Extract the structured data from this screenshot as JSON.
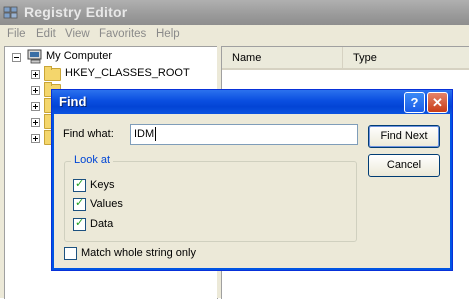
{
  "app": {
    "title": "Registry Editor",
    "menu": [
      "File",
      "Edit",
      "View",
      "Favorites",
      "Help"
    ]
  },
  "tree": {
    "root_label": "My Computer",
    "items": [
      "HKEY_CLASSES_ROOT"
    ]
  },
  "list": {
    "columns": [
      "Name",
      "Type"
    ]
  },
  "find_dialog": {
    "title": "Find",
    "find_what_label": "Find what:",
    "find_what_value": "IDM",
    "find_next_label": "Find Next",
    "cancel_label": "Cancel",
    "look_at_label": "Look at",
    "options": [
      {
        "label": "Keys",
        "checked": true
      },
      {
        "label": "Values",
        "checked": true
      },
      {
        "label": "Data",
        "checked": true
      }
    ],
    "match_whole_label": "Match whole string only",
    "match_whole_checked": false,
    "help_glyph": "?",
    "close_glyph": "✕"
  }
}
